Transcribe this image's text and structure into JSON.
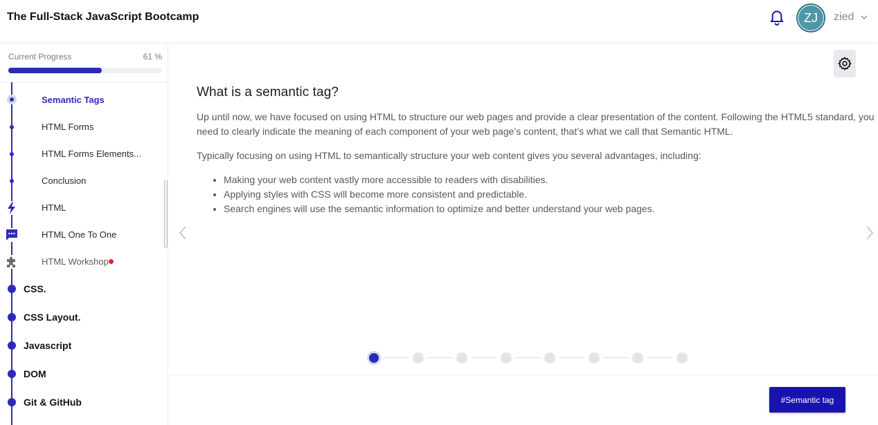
{
  "header": {
    "title": "The Full-Stack JavaScript Bootcamp",
    "avatar_initials": "ZJ",
    "username": "zied",
    "icons": [
      "bell-icon",
      "chevron-down-icon"
    ]
  },
  "sidebar": {
    "progress": {
      "label": "Current Progress",
      "value_text": "61 %",
      "value": 61
    },
    "lessons": [
      {
        "label": "Semantic Tags",
        "state": "active",
        "icon": "dot"
      },
      {
        "label": "HTML Forms",
        "state": "normal",
        "icon": "dot"
      },
      {
        "label": "HTML Forms Elements...",
        "state": "normal",
        "icon": "dot"
      },
      {
        "label": "Conclusion",
        "state": "normal",
        "icon": "dot"
      },
      {
        "label": "HTML",
        "state": "normal",
        "icon": "lightning-icon"
      },
      {
        "label": "HTML One To One",
        "state": "normal",
        "icon": "chat-icon"
      },
      {
        "label": "HTML Workshop",
        "state": "new",
        "icon": "puzzle-icon"
      }
    ],
    "modules": [
      {
        "label": "CSS."
      },
      {
        "label": "CSS Layout."
      },
      {
        "label": "Javascript"
      },
      {
        "label": "DOM"
      },
      {
        "label": "Git & GitHub"
      }
    ],
    "accent_color": "#2e2ab8"
  },
  "main": {
    "heading": "What is a semantic tag?",
    "paragraphs": [
      "Up until now, we have focused on using HTML to structure our web pages and provide a clear presentation of the content. Following the HTML5 standard, you need to clearly indicate the meaning of each component of your web page’s content, that’s what we call that Semantic HTML.",
      "Typically focusing on using HTML to semantically structure your web content gives you several advantages, including:"
    ],
    "bullets": [
      "Making your web content vastly more accessible to readers with disabilities.",
      "Applying styles with CSS will become more consistent and predictable.",
      "Search engines will use the semantic information to optimize and better understand your web pages."
    ],
    "stepper": {
      "total": 8,
      "current": 1
    },
    "tag_button": "#Semantic tag",
    "icons": [
      "gear-icon",
      "chevron-left-icon",
      "chevron-right-icon"
    ]
  }
}
